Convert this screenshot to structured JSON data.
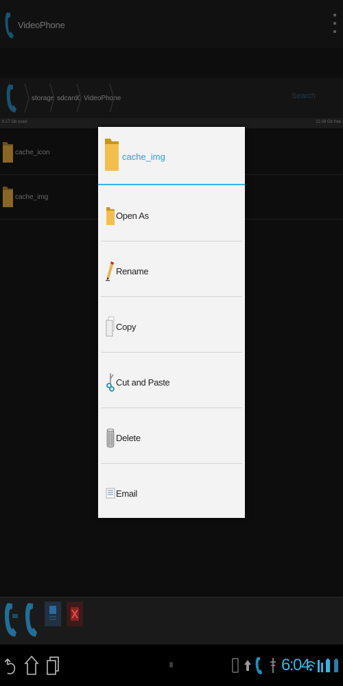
{
  "app": {
    "title": "VideoPhone"
  },
  "path": {
    "crumbs": [
      "storage",
      "sdcard0",
      "VideoPhone"
    ],
    "search_label": "Search"
  },
  "storage": {
    "used": "6.17 Gb used",
    "free": "22.08 Gb free"
  },
  "files": [
    {
      "name": "cache_icon",
      "icon": "folder-icon"
    },
    {
      "name": "cache_img",
      "icon": "folder-icon"
    }
  ],
  "dialog": {
    "title": "cache_img",
    "items": [
      {
        "label": "Open As",
        "icon": "folder-icon"
      },
      {
        "label": "Rename",
        "icon": "pencil-icon"
      },
      {
        "label": "Copy",
        "icon": "copy-icon"
      },
      {
        "label": "Cut and Paste",
        "icon": "scissors-icon"
      },
      {
        "label": "Delete",
        "icon": "trash-icon"
      },
      {
        "label": "Email",
        "icon": "email-icon"
      }
    ]
  },
  "status": {
    "time": "6:04"
  },
  "colors": {
    "accent": "#33b5e5",
    "folder": "#e8b53a",
    "dialog_bg": "#f3f3f3"
  }
}
